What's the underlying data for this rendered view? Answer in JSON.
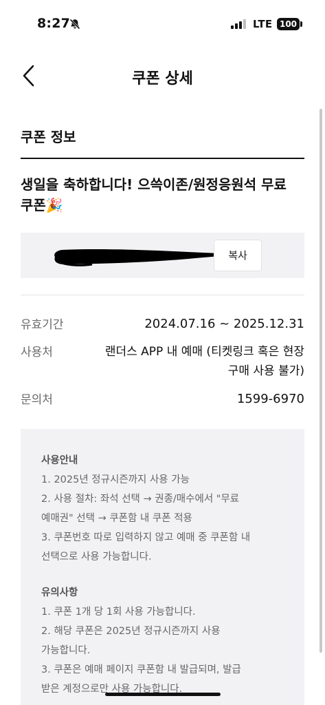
{
  "status_bar": {
    "time": "8:27",
    "network": "LTE",
    "battery": "100",
    "icons": [
      "bell-slash-icon",
      "signal-icon",
      "battery-icon"
    ]
  },
  "nav": {
    "title": "쿠폰 상세",
    "back_icon": "chevron-left-icon"
  },
  "coupon": {
    "section_title": "쿠폰 정보",
    "name": "생일을 축하합니다! 으쓱이존/원정응원석 무료 쿠폰🎉",
    "copy_label": "복사"
  },
  "info": {
    "validity_label": "유효기간",
    "validity_value": "2024.07.16 ~ 2025.12.31",
    "usage_label": "사용처",
    "usage_value": "랜더스 APP 내 예매 (티켓링크 혹은 현장 구매 사용 불가)",
    "contact_label": "문의처",
    "contact_value": "1599-6970"
  },
  "notice": {
    "usage_heading": "사용안내",
    "usage_lines": [
      "1. 2025년 정규시즌까지 사용 가능",
      "2. 사용 절차: 좌석 선택 → 권종/매수에서 \"무료",
      "예매권\" 선택 → 쿠폰함 내 쿠폰 적용",
      "3. 쿠폰번호 따로 입력하지 않고 예매 중 쿠폰함 내",
      "선택으로 사용 가능합니다."
    ],
    "caution_heading": "유의사항",
    "caution_lines": [
      "1. 쿠폰 1개 당 1회 사용 가능합니다.",
      "2. 해당 쿠폰은 2025년 정규시즌까지 사용",
      "가능합니다.",
      "3. 쿠폰은 예매 페이지 쿠폰함 내 발급되며, 발급",
      "받은 계정으로만 사용 가능합니다."
    ]
  }
}
